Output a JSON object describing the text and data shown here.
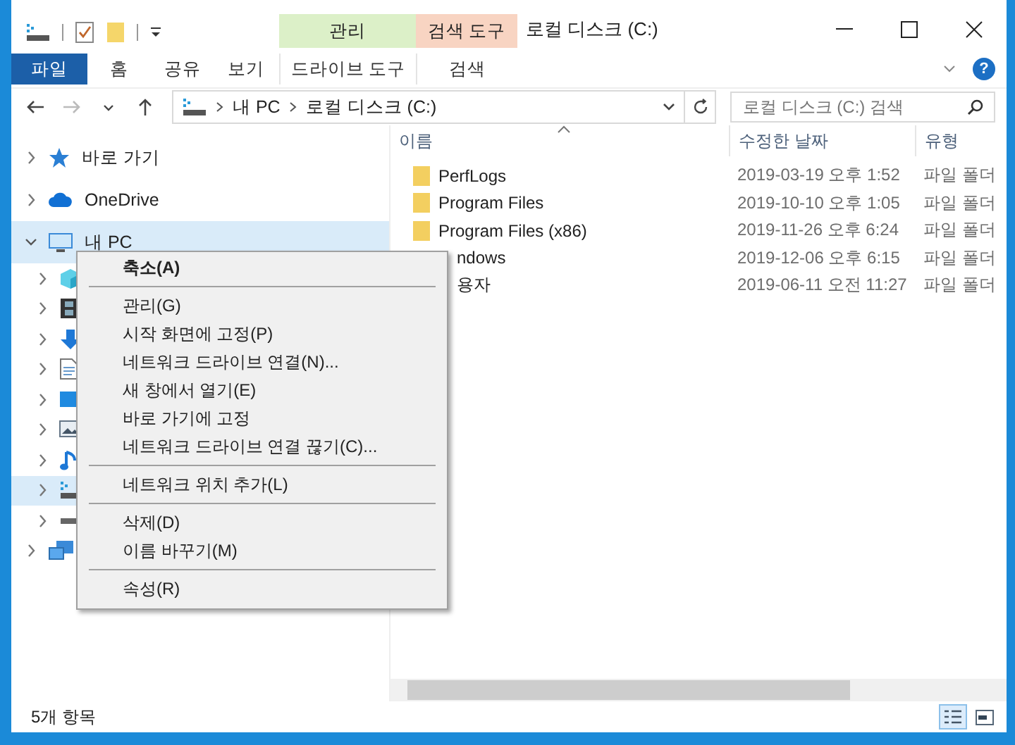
{
  "window": {
    "title": "로컬 디스크 (C:)"
  },
  "quick_access": [
    {
      "kind": "drive"
    },
    {
      "kind": "properties"
    },
    {
      "kind": "folder"
    },
    {
      "kind": "dropdown"
    }
  ],
  "context_groups": [
    {
      "label": "관리",
      "color": "#dcf0c8"
    },
    {
      "label": "검색 도구",
      "color": "#f8d4c2"
    }
  ],
  "ribbon_tabs": [
    {
      "label": "파일",
      "selected": true,
      "kind": "file"
    },
    {
      "label": "홈",
      "selected": false,
      "kind": "plain"
    },
    {
      "label": "공유",
      "selected": false,
      "kind": "plain"
    },
    {
      "label": "보기",
      "selected": false,
      "kind": "plain"
    },
    {
      "label": "드라이브 도구",
      "selected": false,
      "kind": "context"
    },
    {
      "label": "검색",
      "selected": false,
      "kind": "context"
    }
  ],
  "help": "?",
  "nav_buttons": [
    {
      "kind": "back",
      "disabled": false
    },
    {
      "kind": "forward",
      "disabled": true
    },
    {
      "kind": "recent",
      "disabled": false
    },
    {
      "kind": "up",
      "disabled": false
    }
  ],
  "breadcrumb": [
    "내 PC",
    "로컬 디스크 (C:)"
  ],
  "search": {
    "placeholder": "로컬 디스크 (C:) 검색"
  },
  "tree": [
    {
      "label": "바로 가기",
      "kind": "star",
      "expanded": false,
      "selected": false
    },
    {
      "label": "OneDrive",
      "kind": "cloud",
      "expanded": false,
      "selected": false
    },
    {
      "label": "내 PC",
      "kind": "pc",
      "expanded": true,
      "selected": true,
      "children": [
        {
          "kind": "cube",
          "expanded": false,
          "selected": false
        },
        {
          "kind": "video",
          "expanded": false,
          "selected": false
        },
        {
          "kind": "download",
          "expanded": false,
          "selected": false
        },
        {
          "kind": "document",
          "expanded": false,
          "selected": false
        },
        {
          "kind": "desktop",
          "expanded": false,
          "selected": false
        },
        {
          "kind": "pictures",
          "expanded": false,
          "selected": false
        },
        {
          "kind": "music",
          "expanded": false,
          "selected": false
        },
        {
          "kind": "drive",
          "expanded": false,
          "selected": true
        },
        {
          "kind": "dvd",
          "expanded": false,
          "selected": false
        }
      ]
    },
    {
      "kind": "network",
      "expanded": false,
      "selected": false
    }
  ],
  "table": {
    "columns": [
      "이름",
      "수정한 날짜",
      "유형"
    ],
    "rows": [
      {
        "name": "PerfLogs",
        "date": "2019-03-19 오후 1:52",
        "type": "파일 폴더",
        "icon_visible": true
      },
      {
        "name": "Program Files",
        "date": "2019-10-10 오후 1:05",
        "type": "파일 폴더",
        "icon_visible": true
      },
      {
        "name": "Program Files (x86)",
        "date": "2019-11-26 오후 6:24",
        "type": "파일 폴더",
        "icon_visible": true
      },
      {
        "name": "ndows",
        "date": "2019-12-06 오후 6:15",
        "type": "파일 폴더",
        "icon_visible": false
      },
      {
        "name": "용자",
        "date": "2019-06-11 오전 11:27",
        "type": "파일 폴더",
        "icon_visible": false
      }
    ]
  },
  "context_menu": [
    {
      "kind": "default",
      "label": "축소(A)"
    },
    {
      "kind": "separator"
    },
    {
      "kind": "item",
      "label": "관리(G)"
    },
    {
      "kind": "item",
      "label": "시작 화면에 고정(P)"
    },
    {
      "kind": "item",
      "label": "네트워크 드라이브 연결(N)..."
    },
    {
      "kind": "item",
      "label": "새 창에서 열기(E)"
    },
    {
      "kind": "item",
      "label": "바로 가기에 고정"
    },
    {
      "kind": "item",
      "label": "네트워크 드라이브 연결 끊기(C)..."
    },
    {
      "kind": "separator"
    },
    {
      "kind": "item",
      "label": "네트워크 위치 추가(L)"
    },
    {
      "kind": "separator"
    },
    {
      "kind": "item",
      "label": "삭제(D)"
    },
    {
      "kind": "item",
      "label": "이름 바꾸기(M)"
    },
    {
      "kind": "separator"
    },
    {
      "kind": "item",
      "label": "속성(R)"
    }
  ],
  "status_bar": {
    "text": "5개 항목"
  },
  "view_buttons": [
    {
      "kind": "details",
      "selected": true
    },
    {
      "kind": "large-icons",
      "selected": false
    }
  ]
}
